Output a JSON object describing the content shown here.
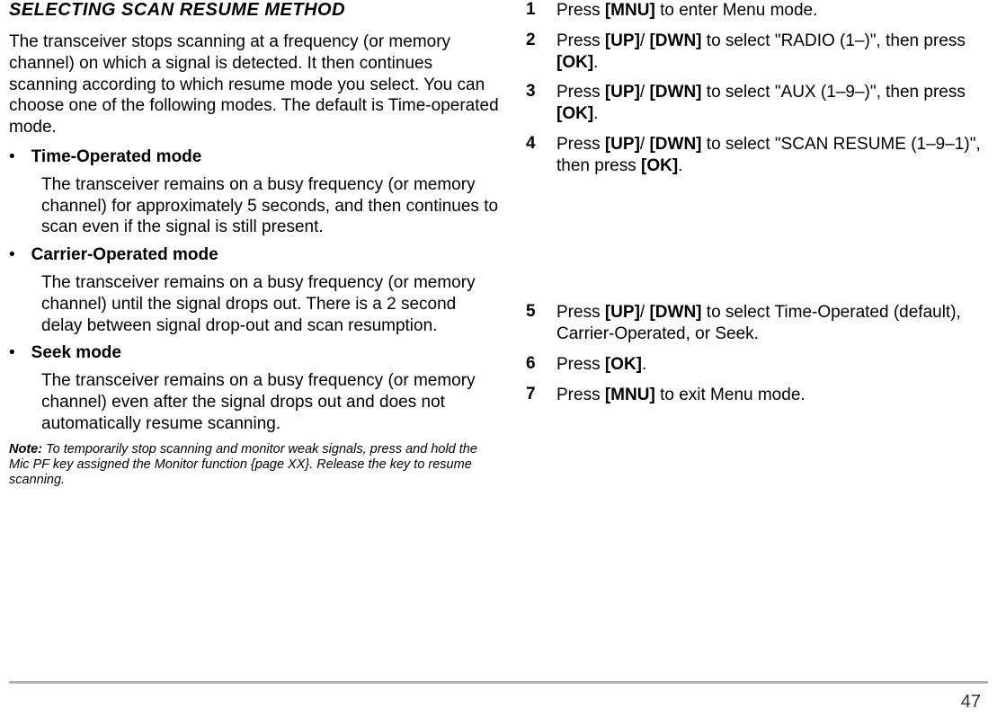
{
  "left": {
    "heading": "SELECTING SCAN RESUME METHOD",
    "intro": "The transceiver stops scanning at a frequency (or memory channel) on which a signal is detected.  It then continues scanning according to which resume mode you select.  You can choose one of the following modes.  The default is Time-operated mode.",
    "modes": [
      {
        "name": "Time-Operated mode",
        "desc": "The transceiver remains on a busy frequency (or memory channel) for approximately 5 seconds, and then continues to scan even if the signal is still present."
      },
      {
        "name": "Carrier-Operated mode",
        "desc": "The transceiver remains on a busy frequency (or memory channel) until the signal drops out.  There is a 2 second delay between signal drop-out and scan resumption."
      },
      {
        "name": "Seek mode",
        "desc": "The transceiver remains on a busy frequency (or memory channel) even after the signal drops out and does not automatically resume scanning."
      }
    ],
    "note_label": "Note:",
    "note_text": "  To temporarily stop scanning and monitor weak signals, press and hold the Mic PF key assigned the Monitor function {page XX}.  Release the key to resume scanning."
  },
  "right": {
    "steps": [
      {
        "num": "1",
        "parts": [
          "Press ",
          "[MNU]",
          " to enter Menu mode."
        ]
      },
      {
        "num": "2",
        "parts": [
          "Press ",
          "[UP]",
          "/ ",
          "[DWN]",
          " to select \"RADIO (1–)\", then press ",
          "[OK]",
          "."
        ]
      },
      {
        "num": "3",
        "parts": [
          "Press ",
          "[UP]",
          "/ ",
          "[DWN]",
          " to select \"AUX (1–9–)\", then press ",
          "[OK]",
          "."
        ]
      },
      {
        "num": "4",
        "parts": [
          "Press ",
          "[UP]",
          "/ ",
          "[DWN]",
          " to select \"SCAN RESUME  (1–9–1)\", then press ",
          "[OK]",
          "."
        ]
      },
      {
        "num": "5",
        "parts": [
          "Press ",
          "[UP]",
          "/ ",
          "[DWN]",
          " to select Time-Operated (default), Carrier-Operated, or Seek."
        ]
      },
      {
        "num": "6",
        "parts": [
          "Press ",
          "[OK]",
          "."
        ]
      },
      {
        "num": "7",
        "parts": [
          "Press ",
          "[MNU]",
          " to exit Menu mode."
        ]
      }
    ]
  },
  "page_number": "47",
  "bullet": "•",
  "gap_after_step": 3
}
